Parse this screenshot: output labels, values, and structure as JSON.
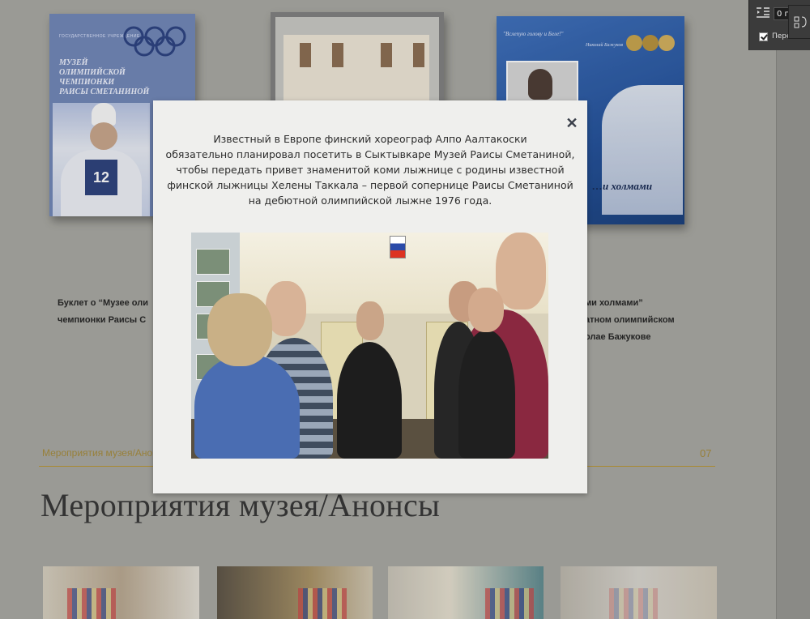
{
  "books": [
    {
      "tiny_line": "ГОСУДАРСТВЕННОЕ УЧРЕЖДЕНИЕ",
      "title_line1": "Музей",
      "title_line2": "олимпийской чемпионки",
      "title_line3": "Раисы Сметаниной",
      "bib_number": "12"
    },
    {},
    {
      "quote": "\"Вслепую голову и Беле!\"",
      "signature": "Николай Бажуков",
      "title": "…и холмами"
    }
  ],
  "captions": {
    "left_line1": "Буклет о “Музее оли",
    "left_line2": "чемпионки Раисы С",
    "right_line1": "ми холмами”",
    "right_line2": "атном олимпийском",
    "right_line3": "олае Бажукове"
  },
  "section": {
    "label": "Мероприятия музея/Анон",
    "number": "07",
    "heading": "Мероприятия музея/Анонсы"
  },
  "modal": {
    "lines": [
      "Известный в Европе финский хореограф Алпо Аалтакоски",
      "обязательно планировал посетить в Сыктывкаре Музей Раисы Сметаниной,",
      "чтобы передать привет знаменитой коми лыжнице с родины известной",
      "финской лыжницы Хелены Таккала – первой сопернице Раисы Сметаниной",
      "на дебютной олимпийской лыжне 1976 года."
    ],
    "close_glyph": "✕"
  },
  "tool_panel": {
    "field_value": "0 г",
    "checkbox_label": "Переносы",
    "checkbox_checked": true
  }
}
